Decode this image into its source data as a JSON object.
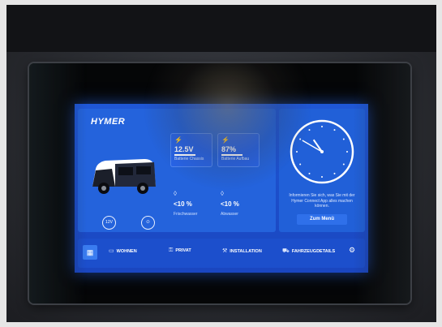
{
  "brand": {
    "logo_text": "HYMER"
  },
  "status_tiles": [
    {
      "icon": "lightning-icon",
      "glyph": "⚡",
      "value": "12.5V",
      "label": "Batterie Chassis"
    },
    {
      "icon": "lightning-icon",
      "glyph": "⚡",
      "value": "87%",
      "label": "Batterie Aufbau"
    }
  ],
  "tanks": [
    {
      "icon": "water-drop-icon",
      "glyph": "💧",
      "value": "<10 %",
      "label": "Frischwasser"
    },
    {
      "icon": "water-drop-icon",
      "glyph": "💧",
      "value": "<10 %",
      "label": "Abwasser"
    }
  ],
  "quick_buttons": [
    {
      "name": "voltage-button",
      "text": "12V"
    },
    {
      "name": "power-button",
      "text": "⏻"
    }
  ],
  "clock": {
    "hour": 10,
    "minute": 50
  },
  "info": {
    "text": "Informieren Sie sich, was Sie mit der Hymer Connect App alles machen können.",
    "button_label": "Zum Menü"
  },
  "nav": {
    "home_glyph": "▦",
    "items": [
      {
        "name": "nav-wohnen",
        "icon": "sofa-icon",
        "glyph": "▭",
        "label": "WOHNEN"
      },
      {
        "name": "nav-privat",
        "icon": "user-icon",
        "glyph": "⚿",
        "label": "PRIVAT"
      },
      {
        "name": "nav-installation",
        "icon": "installation-icon",
        "glyph": "⚒",
        "label": "INSTALLATION"
      },
      {
        "name": "nav-fahrzeugdetails",
        "icon": "vehicle-icon",
        "glyph": "⛟",
        "label": "FAHRZEUGDETAILS"
      }
    ],
    "settings_glyph": "⚙"
  },
  "colors": {
    "screen_blue": "#1f57d6",
    "panel_blue": "#2463dc",
    "nav_blue": "#1c4fcc"
  }
}
